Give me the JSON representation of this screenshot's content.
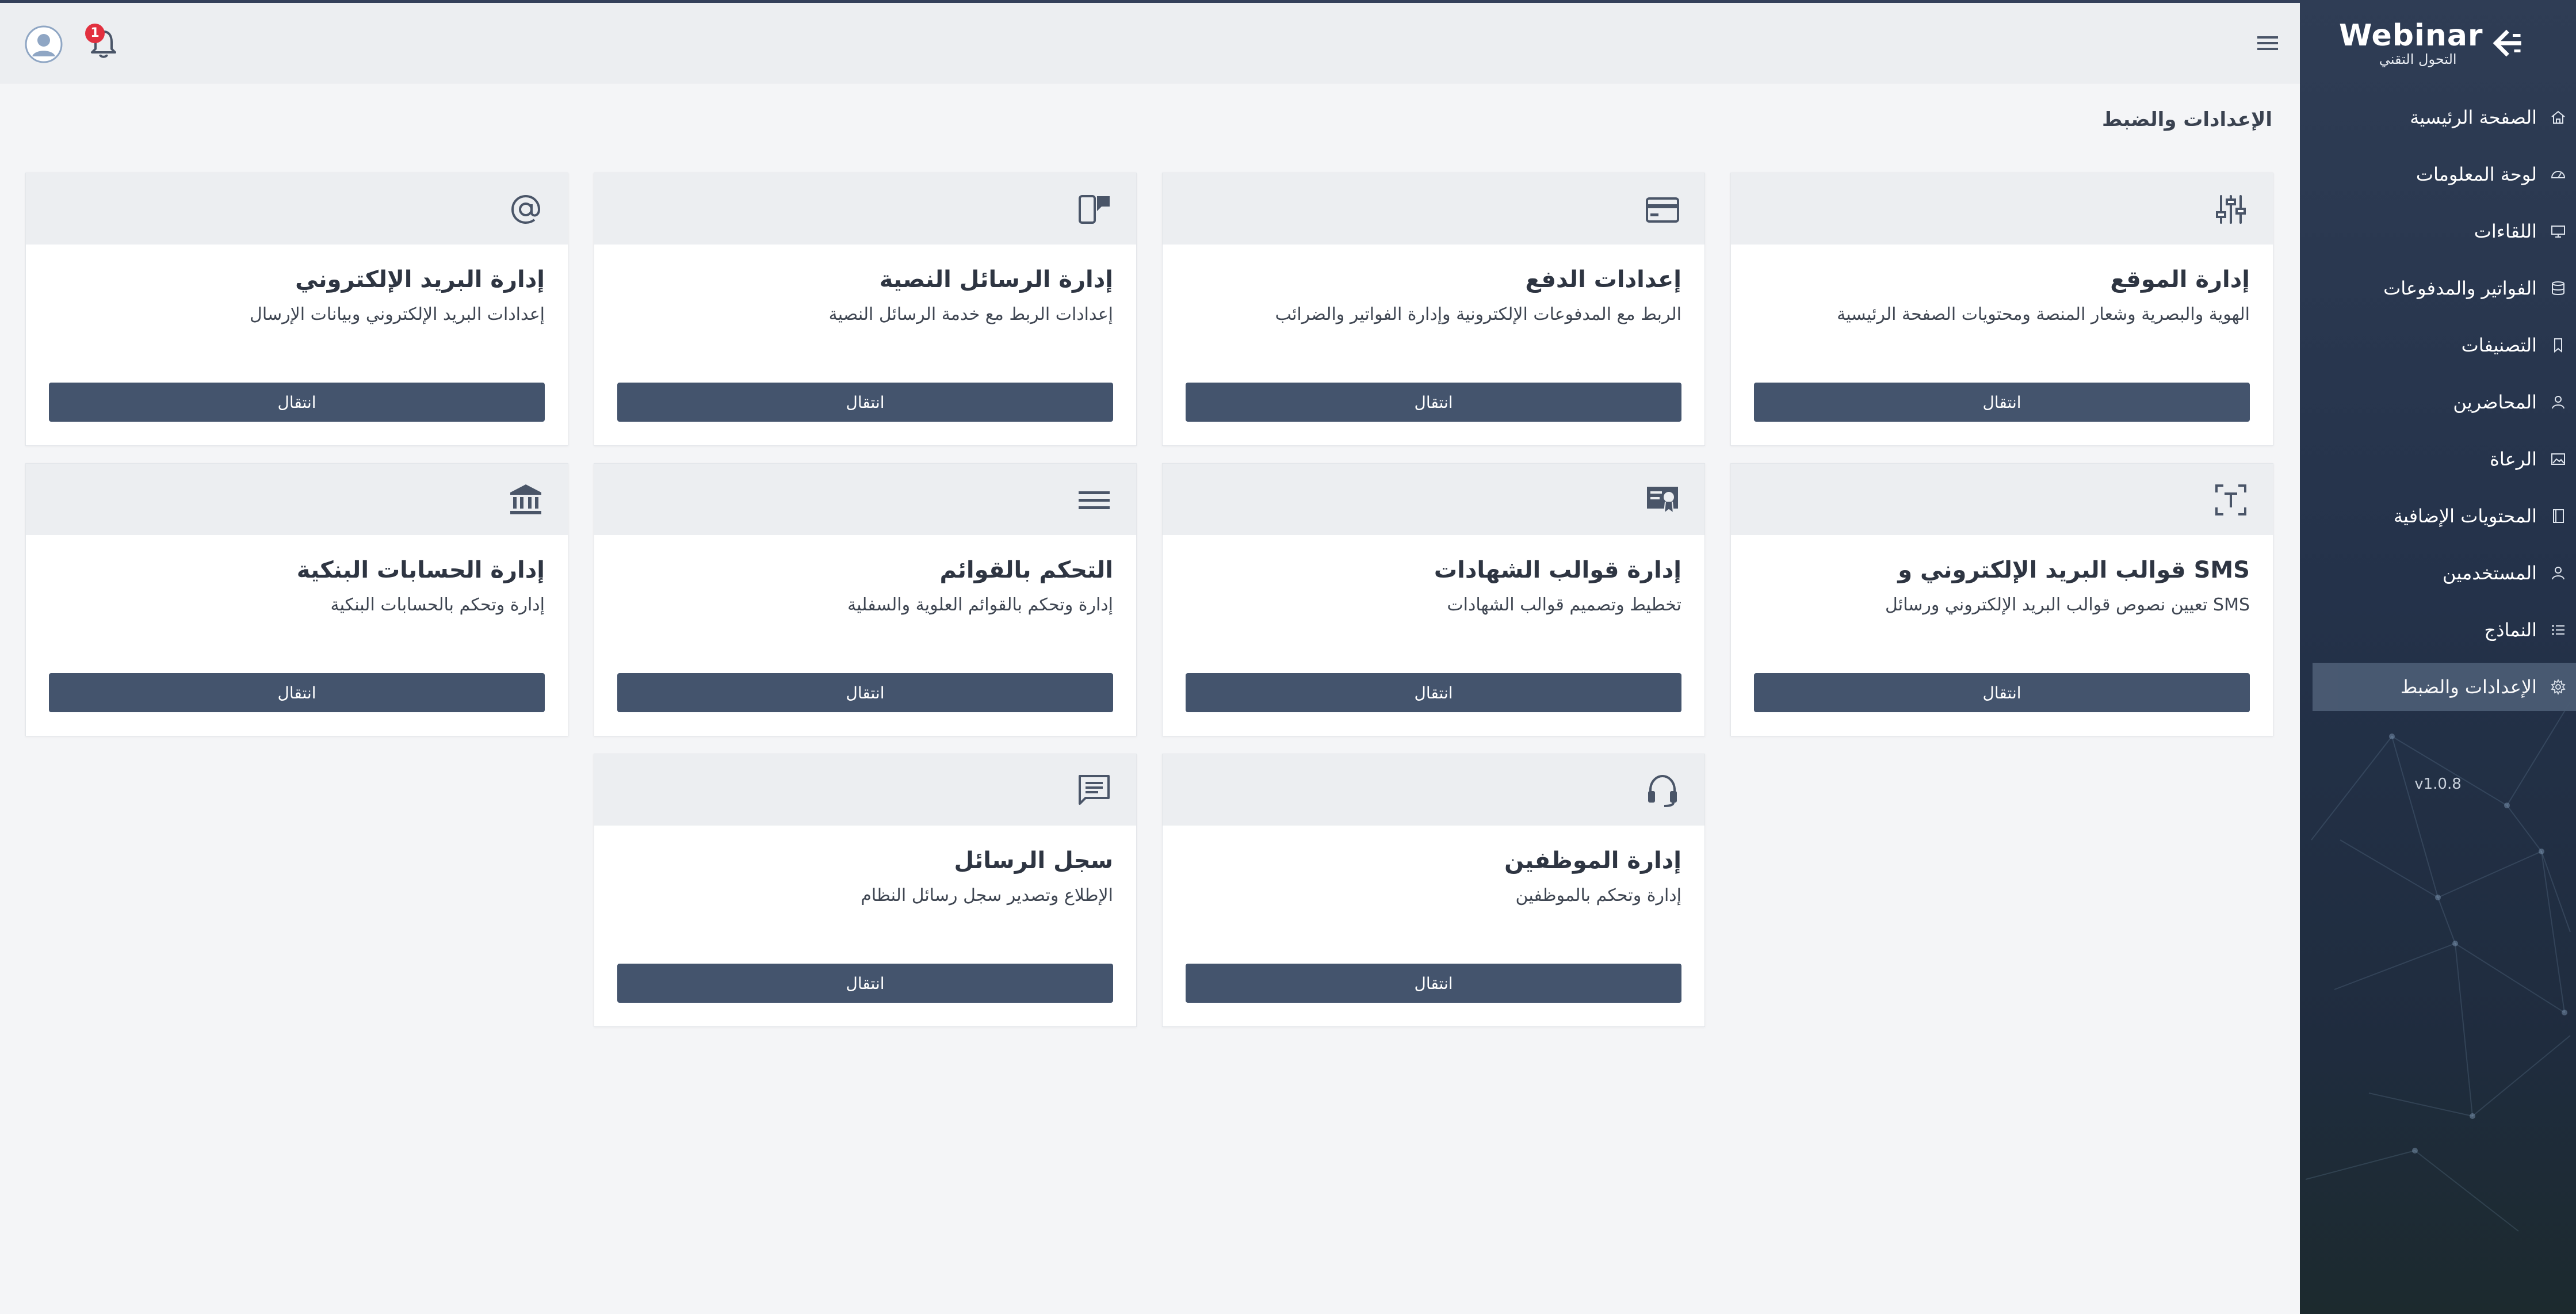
{
  "app": {
    "brand_name": "Webinar",
    "brand_sub": "التحول التقني",
    "version": "v1.0.8",
    "notification_count": "1",
    "accent_color": "#44546d"
  },
  "sidebar": {
    "items": [
      {
        "label": "الصفحة الرئيسية",
        "icon": "home-icon"
      },
      {
        "label": "لوحة المعلومات",
        "icon": "dashboard-gauge-icon"
      },
      {
        "label": "اللقاءات",
        "icon": "monitor-icon"
      },
      {
        "label": "الفواتير والمدفوعات",
        "icon": "database-icon"
      },
      {
        "label": "التصنيفات",
        "icon": "bookmark-icon"
      },
      {
        "label": "المحاضرين",
        "icon": "user-icon"
      },
      {
        "label": "الرعاة",
        "icon": "image-icon"
      },
      {
        "label": "المحتويات الإضافية",
        "icon": "book-icon"
      },
      {
        "label": "المستخدمين",
        "icon": "users-icon"
      },
      {
        "label": "النماذج",
        "icon": "list-icon"
      },
      {
        "label": "الإعدادات والضبط",
        "icon": "gear-icon",
        "active": true
      }
    ]
  },
  "page": {
    "title": "الإعدادات والضبط"
  },
  "cards": [
    {
      "title": "إدارة الموقع",
      "desc": "الهوية والبصرية وشعار المنصة ومحتويات الصفحة الرئيسية",
      "button": "انتقال",
      "icon": "sliders-icon"
    },
    {
      "title": "إعدادات الدفع",
      "desc": "الربط مع المدفوعات الإلكترونية وإدارة الفواتير والضرائب",
      "button": "انتقال",
      "icon": "credit-card-icon"
    },
    {
      "title": "إدارة الرسائل النصية",
      "desc": "إعدادات الربط مع خدمة الرسائل النصية",
      "button": "انتقال",
      "icon": "mobile-message-icon"
    },
    {
      "title": "إدارة البريد الإلكتروني",
      "desc": "إعدادات البريد الإلكتروني وبيانات الإرسال",
      "button": "انتقال",
      "icon": "at-sign-icon"
    },
    {
      "title": "قوالب البريد الإلكتروني و SMS",
      "desc": "تعيين نصوص قوالب البريد الإلكتروني ورسائل SMS",
      "button": "انتقال",
      "icon": "text-frame-icon"
    },
    {
      "title": "إدارة قوالب الشهادات",
      "desc": "تخطيط وتصميم قوالب الشهادات",
      "button": "انتقال",
      "icon": "certificate-icon"
    },
    {
      "title": "التحكم بالقوائم",
      "desc": "إدارة وتحكم بالقوائم العلوية والسفلية",
      "button": "انتقال",
      "icon": "menu-lines-icon"
    },
    {
      "title": "إدارة الحسابات البنكية",
      "desc": "إدارة وتحكم بالحسابات البنكية",
      "button": "انتقال",
      "icon": "bank-icon"
    },
    {
      "title": "إدارة الموظفين",
      "desc": "إدارة وتحكم بالموظفين",
      "button": "انتقال",
      "icon": "headset-icon"
    },
    {
      "title": "سجل الرسائل",
      "desc": "الإطلاع وتصدير سجل رسائل النظام",
      "button": "انتقال",
      "icon": "chat-log-icon"
    }
  ]
}
